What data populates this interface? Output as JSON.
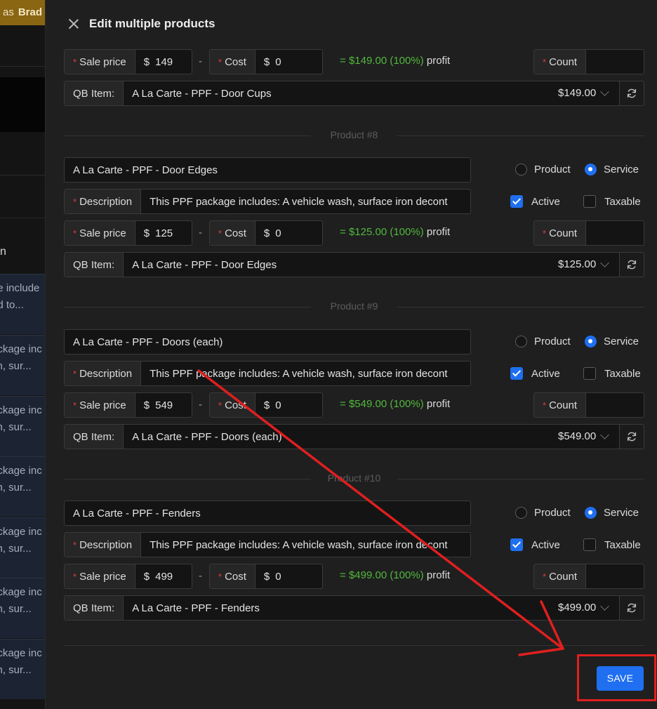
{
  "background": {
    "banner_as": "as",
    "banner_user": "Brad",
    "heading_fragment": "n",
    "list_rows": [
      {
        "line1": "ge include",
        "line2": "ed to..."
      },
      {
        "line1": "ackage inc",
        "line2": "sh, sur..."
      },
      {
        "line1": "ackage inc",
        "line2": "sh, sur..."
      },
      {
        "line1": "ackage inc",
        "line2": "sh, sur..."
      },
      {
        "line1": "ackage inc",
        "line2": "sh, sur..."
      },
      {
        "line1": "ackage inc",
        "line2": "sh, sur..."
      },
      {
        "line1": "ackage inc",
        "line2": "sh, sur..."
      }
    ]
  },
  "modal": {
    "title": "Edit multiple products",
    "close_icon": "close-icon",
    "save_label": "SAVE"
  },
  "labels": {
    "sale_price": "Sale price",
    "cost": "Cost",
    "count": "Count",
    "description": "Description",
    "qb_item": "QB Item:",
    "product": "Product",
    "service": "Service",
    "active": "Active",
    "taxable": "Taxable",
    "currency": "$",
    "profit_word": "profit",
    "dash": "-",
    "equals": "=",
    "required_mark": "*"
  },
  "top_partial": {
    "sale_price": "149",
    "cost": "0",
    "profit": "$149.00 (100%)",
    "count": "",
    "qb_item": "A La Carte - PPF - Door Cups",
    "qb_price": "$149.00"
  },
  "products": [
    {
      "heading": "Product #8",
      "name": "A La Carte - PPF - Door Edges",
      "description": "This PPF package includes:  A vehicle wash, surface iron decont",
      "type": "Service",
      "active": true,
      "taxable": false,
      "sale_price": "125",
      "cost": "0",
      "profit": "$125.00 (100%)",
      "count": "",
      "qb_item": "A La Carte - PPF - Door Edges",
      "qb_price": "$125.00"
    },
    {
      "heading": "Product #9",
      "name": "A La Carte - PPF - Doors (each)",
      "description": "This PPF package includes:  A vehicle wash, surface iron decont",
      "type": "Service",
      "active": true,
      "taxable": false,
      "sale_price": "549",
      "cost": "0",
      "profit": "$549.00 (100%)",
      "count": "",
      "qb_item": "A La Carte - PPF - Doors (each)",
      "qb_price": "$549.00"
    },
    {
      "heading": "Product #10",
      "name": "A La Carte - PPF - Fenders",
      "description": "This PPF package includes:  A vehicle wash, surface iron decont",
      "type": "Service",
      "active": true,
      "taxable": false,
      "sale_price": "499",
      "cost": "0",
      "profit": "$499.00 (100%)",
      "count": "",
      "qb_item": "A La Carte - PPF - Fenders",
      "qb_price": "$499.00"
    }
  ],
  "colors": {
    "accent": "#1f6ff0",
    "profit_green": "#51b83d",
    "required_red": "#e23b3b",
    "annotation_red": "#e01f1f"
  }
}
